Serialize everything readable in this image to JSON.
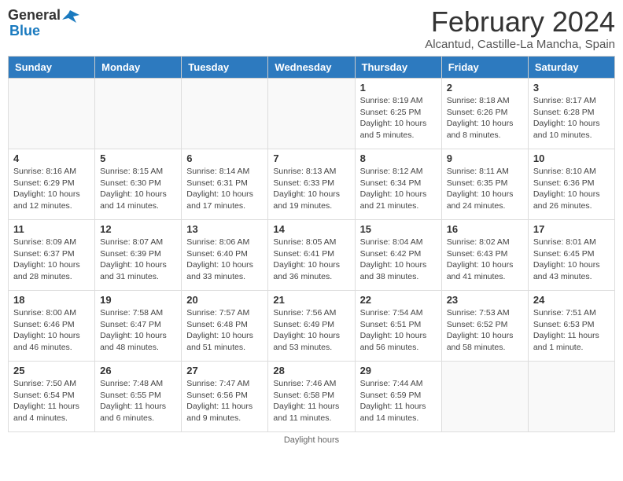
{
  "header": {
    "logo_general": "General",
    "logo_blue": "Blue",
    "month_title": "February 2024",
    "location": "Alcantud, Castille-La Mancha, Spain"
  },
  "days_of_week": [
    "Sunday",
    "Monday",
    "Tuesday",
    "Wednesday",
    "Thursday",
    "Friday",
    "Saturday"
  ],
  "weeks": [
    [
      {
        "day": "",
        "info": ""
      },
      {
        "day": "",
        "info": ""
      },
      {
        "day": "",
        "info": ""
      },
      {
        "day": "",
        "info": ""
      },
      {
        "day": "1",
        "info": "Sunrise: 8:19 AM\nSunset: 6:25 PM\nDaylight: 10 hours and 5 minutes."
      },
      {
        "day": "2",
        "info": "Sunrise: 8:18 AM\nSunset: 6:26 PM\nDaylight: 10 hours and 8 minutes."
      },
      {
        "day": "3",
        "info": "Sunrise: 8:17 AM\nSunset: 6:28 PM\nDaylight: 10 hours and 10 minutes."
      }
    ],
    [
      {
        "day": "4",
        "info": "Sunrise: 8:16 AM\nSunset: 6:29 PM\nDaylight: 10 hours and 12 minutes."
      },
      {
        "day": "5",
        "info": "Sunrise: 8:15 AM\nSunset: 6:30 PM\nDaylight: 10 hours and 14 minutes."
      },
      {
        "day": "6",
        "info": "Sunrise: 8:14 AM\nSunset: 6:31 PM\nDaylight: 10 hours and 17 minutes."
      },
      {
        "day": "7",
        "info": "Sunrise: 8:13 AM\nSunset: 6:33 PM\nDaylight: 10 hours and 19 minutes."
      },
      {
        "day": "8",
        "info": "Sunrise: 8:12 AM\nSunset: 6:34 PM\nDaylight: 10 hours and 21 minutes."
      },
      {
        "day": "9",
        "info": "Sunrise: 8:11 AM\nSunset: 6:35 PM\nDaylight: 10 hours and 24 minutes."
      },
      {
        "day": "10",
        "info": "Sunrise: 8:10 AM\nSunset: 6:36 PM\nDaylight: 10 hours and 26 minutes."
      }
    ],
    [
      {
        "day": "11",
        "info": "Sunrise: 8:09 AM\nSunset: 6:37 PM\nDaylight: 10 hours and 28 minutes."
      },
      {
        "day": "12",
        "info": "Sunrise: 8:07 AM\nSunset: 6:39 PM\nDaylight: 10 hours and 31 minutes."
      },
      {
        "day": "13",
        "info": "Sunrise: 8:06 AM\nSunset: 6:40 PM\nDaylight: 10 hours and 33 minutes."
      },
      {
        "day": "14",
        "info": "Sunrise: 8:05 AM\nSunset: 6:41 PM\nDaylight: 10 hours and 36 minutes."
      },
      {
        "day": "15",
        "info": "Sunrise: 8:04 AM\nSunset: 6:42 PM\nDaylight: 10 hours and 38 minutes."
      },
      {
        "day": "16",
        "info": "Sunrise: 8:02 AM\nSunset: 6:43 PM\nDaylight: 10 hours and 41 minutes."
      },
      {
        "day": "17",
        "info": "Sunrise: 8:01 AM\nSunset: 6:45 PM\nDaylight: 10 hours and 43 minutes."
      }
    ],
    [
      {
        "day": "18",
        "info": "Sunrise: 8:00 AM\nSunset: 6:46 PM\nDaylight: 10 hours and 46 minutes."
      },
      {
        "day": "19",
        "info": "Sunrise: 7:58 AM\nSunset: 6:47 PM\nDaylight: 10 hours and 48 minutes."
      },
      {
        "day": "20",
        "info": "Sunrise: 7:57 AM\nSunset: 6:48 PM\nDaylight: 10 hours and 51 minutes."
      },
      {
        "day": "21",
        "info": "Sunrise: 7:56 AM\nSunset: 6:49 PM\nDaylight: 10 hours and 53 minutes."
      },
      {
        "day": "22",
        "info": "Sunrise: 7:54 AM\nSunset: 6:51 PM\nDaylight: 10 hours and 56 minutes."
      },
      {
        "day": "23",
        "info": "Sunrise: 7:53 AM\nSunset: 6:52 PM\nDaylight: 10 hours and 58 minutes."
      },
      {
        "day": "24",
        "info": "Sunrise: 7:51 AM\nSunset: 6:53 PM\nDaylight: 11 hours and 1 minute."
      }
    ],
    [
      {
        "day": "25",
        "info": "Sunrise: 7:50 AM\nSunset: 6:54 PM\nDaylight: 11 hours and 4 minutes."
      },
      {
        "day": "26",
        "info": "Sunrise: 7:48 AM\nSunset: 6:55 PM\nDaylight: 11 hours and 6 minutes."
      },
      {
        "day": "27",
        "info": "Sunrise: 7:47 AM\nSunset: 6:56 PM\nDaylight: 11 hours and 9 minutes."
      },
      {
        "day": "28",
        "info": "Sunrise: 7:46 AM\nSunset: 6:58 PM\nDaylight: 11 hours and 11 minutes."
      },
      {
        "day": "29",
        "info": "Sunrise: 7:44 AM\nSunset: 6:59 PM\nDaylight: 11 hours and 14 minutes."
      },
      {
        "day": "",
        "info": ""
      },
      {
        "day": "",
        "info": ""
      }
    ]
  ],
  "footer": "Daylight hours"
}
